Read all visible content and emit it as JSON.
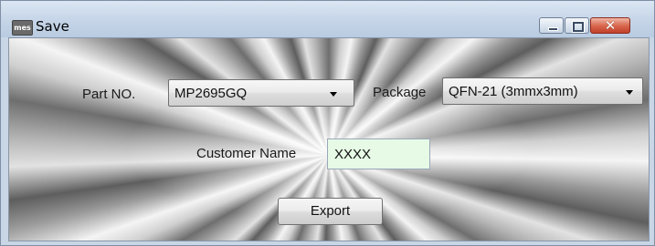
{
  "window": {
    "title": "Save",
    "icon": "mes-app-icon",
    "icon_text": "mes",
    "close_glyph": "✕"
  },
  "form": {
    "part_no_label": "Part NO.",
    "part_no_value": "MP2695GQ",
    "package_label": "Package",
    "package_value": "QFN-21 (3mmx3mm)",
    "customer_name_label": "Customer Name",
    "customer_name_value": "XXXX",
    "export_label": "Export"
  },
  "colors": {
    "customer_name_field_bg": "#e6fae6",
    "close_button": "#d9694f",
    "titlebar": "#c7d6e8"
  }
}
